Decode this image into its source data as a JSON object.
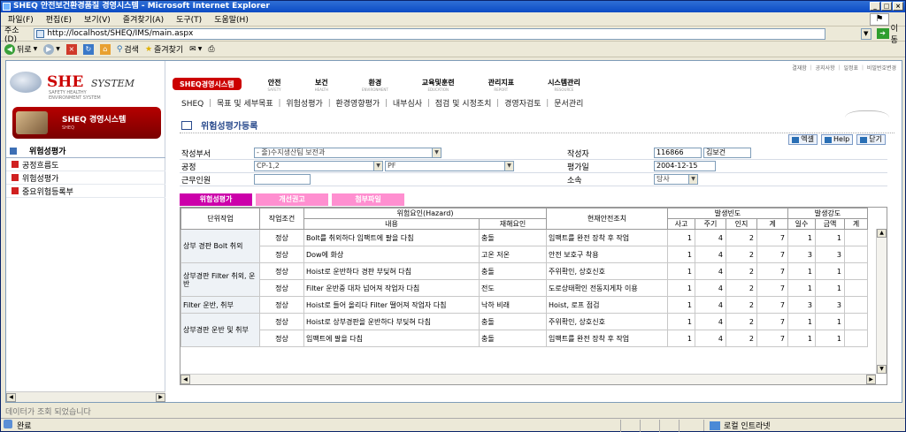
{
  "window": {
    "title": "SHEQ 안전보건환경품질 경영시스템 - Microsoft Internet Explorer"
  },
  "menu": [
    "파일(F)",
    "편집(E)",
    "보기(V)",
    "즐겨찾기(A)",
    "도구(T)",
    "도움말(H)"
  ],
  "address": {
    "label": "주소(D)",
    "url": "http://localhost/SHEQ/IMS/main.aspx",
    "go_label": "이동"
  },
  "toolbar": {
    "back": "뒤로",
    "search": "검색",
    "favorites": "즐겨찾기"
  },
  "brand": {
    "she": "SHE",
    "system": "SYSTEM",
    "sub1": "SAFETY HEALTHY",
    "sub2": "ENVIRONMENT SYSTEM"
  },
  "sheq_card": {
    "title": "SHEQ 경영시스템",
    "sub": "SHEQ"
  },
  "sidebar": {
    "heading": "위험성평가",
    "items": [
      "공정흐름도",
      "위험성평가",
      "중요위험등록부"
    ]
  },
  "top_links": "결재함 ｜ 공지사항 ｜ 일정표 ｜ 비밀번호변경",
  "gnb": {
    "active": "SHEQ경영시스템",
    "items": [
      {
        "ko": "안전",
        "en": "SAFETY"
      },
      {
        "ko": "보건",
        "en": "HEALTH"
      },
      {
        "ko": "환경",
        "en": "ENVIRONMENT"
      },
      {
        "ko": "교육및훈련",
        "en": "EDUCATION"
      },
      {
        "ko": "관리지표",
        "en": "REPORT"
      },
      {
        "ko": "시스템관리",
        "en": "RESOURCE"
      }
    ]
  },
  "subnav": "SHEQ ｜ 목표 및 세부목표 ｜ 위험성평가 ｜ 환경영향평가 ｜ 내부심사 ｜ 점검 및 시정조치 ｜ 경영자검토 ｜ 문서관리",
  "page_title": "위험성평가등록",
  "actions": {
    "excel": "엑셀",
    "help": "Help",
    "close": "닫기"
  },
  "form": {
    "dept_label": "작성부서",
    "dept_value": "- 줄)수지생산팀 보전과",
    "process_label": "공정",
    "process_value1": "CP-1,2",
    "process_value2": "PF",
    "workers_label": "근무인원",
    "workers_value": "",
    "author_label": "작성자",
    "author_id": "116866",
    "author_name": "김보건",
    "date_label": "평가일",
    "date_value": "2004-12-15",
    "belong_label": "소속",
    "belong_value": "당사"
  },
  "tabs": [
    "위험성평가",
    "개선권고",
    "첨부파일"
  ],
  "table": {
    "headers": {
      "work": "단위작업",
      "cond": "작업조건",
      "hazard": "위험요인(Hazard)",
      "content": "내용",
      "harm": "재해요인",
      "measure": "현재안전조치",
      "freq": "발생빈도",
      "sev": "발생강도",
      "f_cols": [
        "사고",
        "주기",
        "인지",
        "계"
      ],
      "s_cols": [
        "일수",
        "금액",
        "계"
      ]
    },
    "groups": [
      {
        "work": "상부 경판 Bolt 취외",
        "rows": [
          {
            "cond": "정상",
            "content": "Bolt를 취외하다 임팩트에 팔을 다침",
            "harm": "충돌",
            "measure": "임팩트를 완전 장착 후 작업",
            "f": [
              "1",
              "4",
              "2",
              "7"
            ],
            "s": [
              "1",
              "1",
              ""
            ]
          },
          {
            "cond": "정상",
            "content": "Dow에 화상",
            "harm": "고온 저온",
            "measure": "안전 보호구 착용",
            "f": [
              "1",
              "4",
              "2",
              "7"
            ],
            "s": [
              "3",
              "3",
              ""
            ]
          }
        ]
      },
      {
        "work": "상부경판 Filter 취외, 운반",
        "rows": [
          {
            "cond": "정상",
            "content": "Hoist로 운반하다 경판 부딪혀 다침",
            "harm": "충돌",
            "measure": "주위확인, 상호신호",
            "f": [
              "1",
              "4",
              "2",
              "7"
            ],
            "s": [
              "1",
              "1",
              ""
            ]
          },
          {
            "cond": "정상",
            "content": "Filter 운반중 대차 넘어져 작업자 다침",
            "harm": "전도",
            "measure": "도로상태확인 전동지게차 이용",
            "f": [
              "1",
              "4",
              "2",
              "7"
            ],
            "s": [
              "1",
              "1",
              ""
            ]
          }
        ]
      },
      {
        "work": "Filter 운반, 취부",
        "rows": [
          {
            "cond": "정상",
            "content": "Hoist로 들어 올리다 Filter 떨어져 작업자 다침",
            "harm": "낙하 비래",
            "measure": "Hoist, 로프 점검",
            "f": [
              "1",
              "4",
              "2",
              "7"
            ],
            "s": [
              "3",
              "3",
              ""
            ]
          }
        ]
      },
      {
        "work": "상부경판 운반 및 취부",
        "rows": [
          {
            "cond": "정상",
            "content": "Hoist로 상부경판을 운반하다 부딪혀 다침",
            "harm": "충돌",
            "measure": "주위확인, 상호신호",
            "f": [
              "1",
              "4",
              "2",
              "7"
            ],
            "s": [
              "1",
              "1",
              ""
            ]
          },
          {
            "cond": "정상",
            "content": "임팩트에 팔을 다침",
            "harm": "충돌",
            "measure": "임팩트를 완전 장착 후 작업",
            "f": [
              "1",
              "4",
              "2",
              "7"
            ],
            "s": [
              "1",
              "1",
              ""
            ]
          }
        ]
      }
    ]
  },
  "load_message": "데이터가 조회 되었습니다",
  "status": {
    "text": "완료",
    "zone": "로컬 인트라넷"
  }
}
